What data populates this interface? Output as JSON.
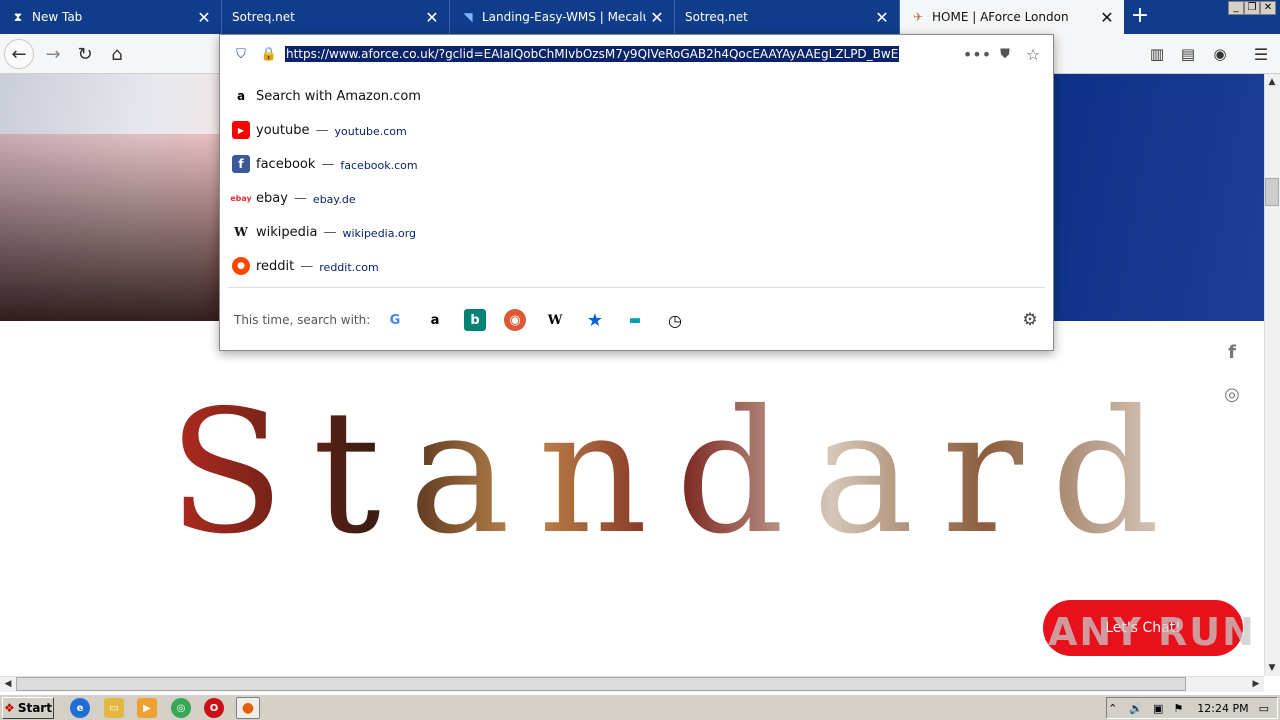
{
  "browser": {
    "tabs": [
      {
        "label": "New Tab",
        "icon": "hourglass-icon"
      },
      {
        "label": "Sotreq.net",
        "icon": ""
      },
      {
        "label": "Landing-Easy-WMS | Mecalux | ww",
        "icon": "mecalux-icon"
      },
      {
        "label": "Sotreq.net",
        "icon": ""
      },
      {
        "label": "HOME | AForce London",
        "icon": "aforce-icon",
        "active": true
      }
    ],
    "new_tab": "+",
    "url": "https://www.aforce.co.uk/?gclid=EAIaIQobChMIvbOzsM7y9QIVeRoGAB2h4QocEAAYAyAAEgLZLPD_BwE"
  },
  "urlbar": {
    "results": [
      {
        "title": "Search with Amazon.com",
        "url": "",
        "icon": "amazon-icon",
        "color": "#000000"
      },
      {
        "title": "youtube",
        "url": "youtube.com",
        "icon": "youtube-icon",
        "color": "#ff0000"
      },
      {
        "title": "facebook",
        "url": "facebook.com",
        "icon": "facebook-icon",
        "color": "#3b5998"
      },
      {
        "title": "ebay",
        "url": "ebay.de",
        "icon": "ebay-icon",
        "color": "#e53238"
      },
      {
        "title": "wikipedia",
        "url": "wikipedia.org",
        "icon": "wikipedia-icon",
        "color": "#000000"
      },
      {
        "title": "reddit",
        "url": "reddit.com",
        "icon": "reddit-icon",
        "color": "#ff4500"
      }
    ],
    "separator": "—",
    "search_with_label": "This time, search with:",
    "engines": [
      "google-icon",
      "amazon-icon",
      "bing-icon",
      "duckduckgo-icon",
      "wikipedia-icon",
      "bookmarks-icon",
      "tabs-icon",
      "history-icon"
    ]
  },
  "page": {
    "headline": "Standard",
    "chat_label": "Let's Chat!",
    "watermark": "ANY RUN"
  },
  "taskbar": {
    "start_label": "Start",
    "clock": "12:24 PM"
  }
}
